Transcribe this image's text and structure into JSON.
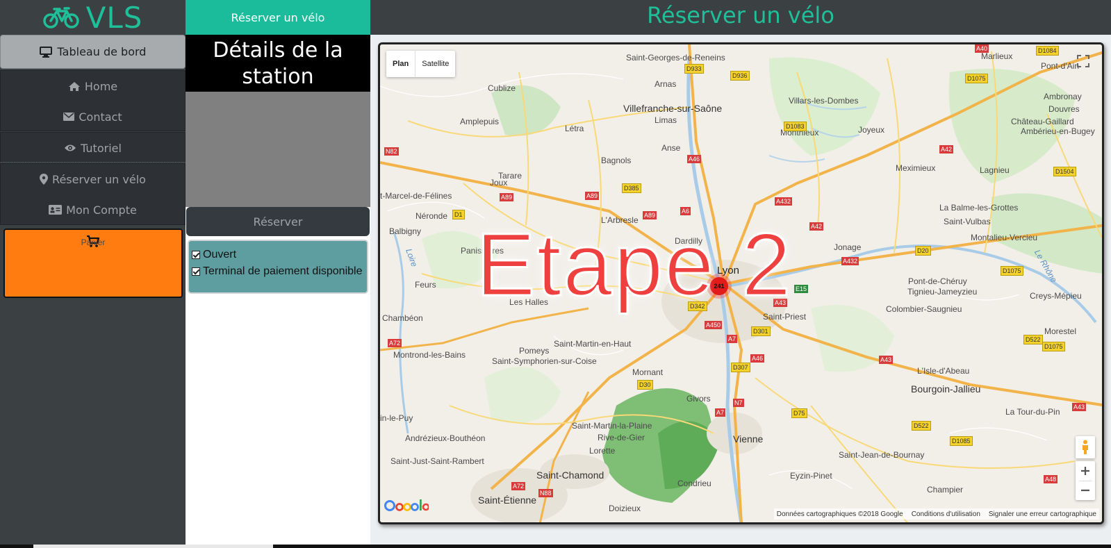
{
  "brand": {
    "name": "VLS",
    "icon": "bicycle-icon",
    "color": "#1fbf99"
  },
  "sidebar": {
    "dashboard": {
      "label": "Tableau de bord",
      "icon": "desktop-icon"
    },
    "items": [
      {
        "label": "Home",
        "icon": "home-icon"
      },
      {
        "label": "Contact",
        "icon": "envelope-icon"
      },
      {
        "label": "Tutoriel",
        "icon": "eye-icon"
      },
      {
        "label": "Réserver un vélo",
        "icon": "map-marker-icon"
      },
      {
        "label": "Mon Compte",
        "icon": "id-card-icon"
      }
    ],
    "cart": {
      "label": "Panier",
      "icon": "cart-icon",
      "color": "#ff7c10"
    }
  },
  "station": {
    "tab_label": "Réserver un vélo",
    "title": "Détails de la station",
    "reserve_label": "Réserver",
    "statuses": [
      {
        "label": "Ouvert",
        "checked": true
      },
      {
        "label": "Terminal de paiement disponible",
        "checked": true
      }
    ]
  },
  "main": {
    "title": "Réserver un vélo"
  },
  "map": {
    "type_buttons": [
      "Plan",
      "Satellite"
    ],
    "active_type": "Plan",
    "overlay_text": "Etape 2",
    "cluster_count": "241",
    "attribution": [
      "Données cartographiques ©2018 Google",
      "Conditions d'utilisation",
      "Signaler une erreur cartographique"
    ],
    "places": {
      "p1": "Saint-Georges-de-Reneins",
      "p2": "Marlieux",
      "p3": "Pont-d'Ain",
      "p4": "Ambronay",
      "p5": "Douvres",
      "p6": "Cublize",
      "p7": "Arnas",
      "p8": "Villars-les-Dombes",
      "p9": "Villefranche-sur-Saône",
      "p10": "Château-Gaillard",
      "p11": "Amplepuis",
      "p12": "Limas",
      "p13": "Joyeux",
      "p14": "Ambérieu-en-Bugey",
      "p15": "Létra",
      "p16": "Monthieux",
      "p17": "Anse",
      "p18": "Bagnols",
      "p19": "Meximieux",
      "p20": "Lagnieu",
      "p21": "Tarare",
      "p22": "Joux",
      "p23": "t-Marcel-de-Félines",
      "p24": "Néronde",
      "p25": "L'Arbresle",
      "p26": "La Balme-les-Grottes",
      "p27": "Saint-Vulbas",
      "p28": "Balbigny",
      "p29": "Dardilly",
      "p30": "Montalieu-Vercieu",
      "p31": "Panissières",
      "p32": "Jonage",
      "p33": "Lyon",
      "p34": "Pont-de-Chéruy",
      "p35": "Tignieu-Jameyzieu",
      "p36": "Feurs",
      "p37": "Les Halles",
      "p38": "Creys-Mépieu",
      "p39": "Colombier-Saugnieu",
      "p40": "Chambéon",
      "p41": "Saint-Priest",
      "p42": "Morestel",
      "p43": "Saint-Martin-en-Haut",
      "p44": "Pomeys",
      "p45": "Montrond-les-Bains",
      "p46": "Saint-Symphorien-sur-Coise",
      "p47": "Mornant",
      "p48": "L'Isle-d'Abeau",
      "p49": "Bourgoin-Jallieu",
      "p50": "Givors",
      "p51": "in-le-Puy",
      "p52": "La Tour-du-Pin",
      "p53": "Saint-Martin-la-Plaine",
      "p54": "Rive-de-Gier",
      "p55": "Andrézieux-Bouthéon",
      "p56": "Vienne",
      "p57": "Lorette",
      "p58": "Saint-Just-Saint-Rambert",
      "p59": "Saint-Jean-de-Bournay",
      "p60": "Saint-Chamond",
      "p61": "Eyzin-Pinet",
      "p62": "Condrieu",
      "p63": "Saint-Étienne",
      "p64": "Champier",
      "p65": "Doizieux",
      "p66": "Loire",
      "p67": "Le Rhône"
    },
    "roads": {
      "r1": "A40",
      "r2": "D1084",
      "r3": "D933",
      "r4": "D936",
      "r5": "D1075",
      "r6": "D1083",
      "r7": "A42",
      "r8": "A46",
      "r9": "N82",
      "r10": "D1504",
      "r11": "A89",
      "r12": "D385",
      "r13": "A89",
      "r14": "D1",
      "r15": "A89",
      "r16": "A6",
      "r17": "A432",
      "r18": "A42",
      "r19": "D20",
      "r20": "A432",
      "r21": "D1075",
      "r22": "E15",
      "r23": "D342",
      "r24": "A43",
      "r25": "A450",
      "r26": "D301",
      "r27": "A7",
      "r28": "A72",
      "r29": "D522",
      "r30": "D1075",
      "r31": "A46",
      "r32": "A43",
      "r33": "D307",
      "r34": "D30",
      "r35": "N7",
      "r36": "A43",
      "r37": "A7",
      "r38": "D75",
      "r39": "D522",
      "r40": "D1085",
      "r41": "A48",
      "r42": "A72",
      "r43": "N88"
    }
  }
}
